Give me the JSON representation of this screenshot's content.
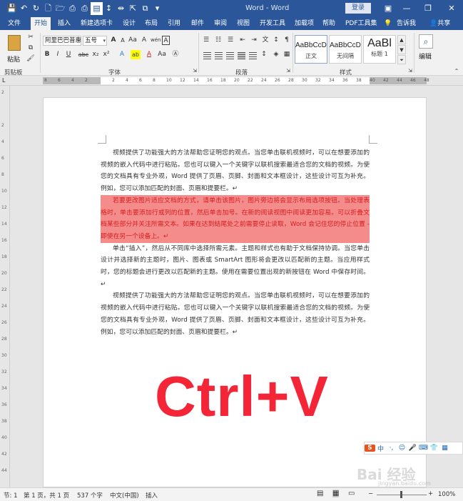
{
  "window": {
    "title": "Word - Word",
    "login_label": "登录",
    "quick_access": [
      {
        "icon": "save-icon",
        "glyph": "💾"
      },
      {
        "icon": "undo-icon",
        "glyph": "↶"
      },
      {
        "icon": "redo-icon",
        "glyph": "↻"
      },
      {
        "icon": "new-doc-icon",
        "glyph": "🗋"
      },
      {
        "icon": "open-folder-icon",
        "glyph": "🗁"
      },
      {
        "icon": "print-preview-icon",
        "glyph": "⎙"
      },
      {
        "icon": "print-icon",
        "glyph": "⎙"
      },
      {
        "icon": "document-icon",
        "glyph": "▤"
      },
      {
        "icon": "line-spacing-icon",
        "glyph": "↕"
      },
      {
        "icon": "distribute-icon",
        "glyph": "⇹"
      },
      {
        "icon": "cursor-icon",
        "glyph": "⇱"
      },
      {
        "icon": "copy-format-icon",
        "glyph": "⧉"
      },
      {
        "icon": "more-icon",
        "glyph": "▾"
      }
    ],
    "controls": [
      {
        "icon": "ribbon-display-icon",
        "glyph": "▣"
      },
      {
        "icon": "minimize-icon",
        "glyph": "—"
      },
      {
        "icon": "restore-icon",
        "glyph": "❐"
      },
      {
        "icon": "close-icon",
        "glyph": "✕"
      }
    ]
  },
  "tabs": [
    "文件",
    "开始",
    "插入",
    "新建选项卡",
    "设计",
    "布局",
    "引用",
    "邮件",
    "审阅",
    "视图",
    "开发工具",
    "加载项",
    "帮助",
    "PDF工具集",
    "告诉我",
    "共享"
  ],
  "active_tab": "开始",
  "ribbon": {
    "paste_label": "粘贴",
    "clipboard_label": "剪贴板",
    "font_label": "字体",
    "paragraph_label": "段落",
    "styles_label": "样式",
    "edit_label": "编辑",
    "font_name": "阿里巴巴普惠",
    "font_size": "五号",
    "font_row2": [
      "B",
      "I",
      "U",
      "abc",
      "x₂",
      "x²"
    ],
    "font_row3": [
      "A",
      "ab",
      "A",
      "Aa",
      "A",
      "A",
      "Ⓐ"
    ],
    "font_row1_extra": [
      "A",
      "A",
      "Aa",
      "A",
      "wén",
      "A"
    ],
    "styles": [
      {
        "preview": "AaBbCcDi",
        "name": "正文"
      },
      {
        "preview": "AaBbCcDi",
        "name": "无间隔"
      },
      {
        "preview": "AaBl",
        "name": "标题 1"
      }
    ]
  },
  "ruler": {
    "h_ticks": [
      "8",
      "6",
      "4",
      "2",
      "",
      "2",
      "4",
      "6",
      "8",
      "10",
      "12",
      "14",
      "16",
      "18",
      "20",
      "22",
      "24",
      "26",
      "28",
      "30",
      "32",
      "34",
      "36",
      "38",
      "40",
      "42",
      "44",
      "46",
      "48"
    ],
    "v_ticks": [
      "2",
      "",
      "2",
      "4",
      "6",
      "8",
      "10",
      "12",
      "14",
      "16",
      "18",
      "20",
      "22",
      "24",
      "26",
      "28",
      "30",
      "32",
      "34",
      "36",
      "38",
      "40",
      "42",
      "44"
    ]
  },
  "document": {
    "paragraphs": [
      {
        "text": "视频提供了功能强大的方法帮助您证明您的观点。当您单击联机视频时，可以在想要添加的视频的嵌入代码中进行粘贴。您也可以键入一个关键字以联机搜索最适合您的文档的视频。为使您的文档具有专业外观，Word 提供了页眉、页脚、封面和文本框设计，这些设计可互为补充。例如，您可以添加匹配的封面、页眉和提要栏。↵",
        "highlight": false
      },
      {
        "text": "若要更改图片适应文档的方式，请单击该图片，图片旁边将会显示布局选项按钮。当处理表格时，单击要添加行或列的位置，然后单击加号。在新的阅读视图中阅读更加容易。可以折叠文档某些部分并关注所需文本。如果在达到结尾处之前需要停止读取，Word 会记住您的停止位置 - 即使在另一个设备上。↵",
        "highlight": true
      },
      {
        "text": "单击“插入”，然后从不同库中选择所需元素。主题和样式也有助于文档保持协调。当您单击设计并选择新的主题时，图片、图表或 SmartArt 图形将会更改以匹配新的主题。当应用样式时，您的标题会进行更改以匹配新的主题。使用在需要位置出现的新按钮在 Word 中保存时间。↵",
        "highlight": false
      },
      {
        "text": "视频提供了功能强大的方法帮助您证明您的观点。当您单击联机视频时，可以在想要添加的视频的嵌入代码中进行粘贴。您也可以键入一个关键字以联机搜索最适合您的文档的视频。为使您的文档具有专业外观，Word 提供了页眉、页脚、封面和文本框设计，这些设计可互为补充。例如，您可以添加匹配的封面、页眉和提要栏。↵",
        "highlight": false
      }
    ],
    "overlay_text": "Ctrl+V"
  },
  "ime_bar": [
    "S",
    "中",
    "·,",
    "☺",
    "🎤",
    "⌨",
    "👕",
    "▦"
  ],
  "watermark": {
    "main": "Bai 经验",
    "sub": "jingyan.baidu.com"
  },
  "status": {
    "section": "节: 1",
    "page": "第 1 页，共 1 页",
    "words": "537 个字",
    "language": "中文(中国)",
    "mode": "插入",
    "zoom": "100%"
  },
  "colors": {
    "brand": "#2b579a",
    "highlight_bg": "#f48c8c",
    "highlight_text": "#d91e1e",
    "overlay": "#f52538"
  }
}
